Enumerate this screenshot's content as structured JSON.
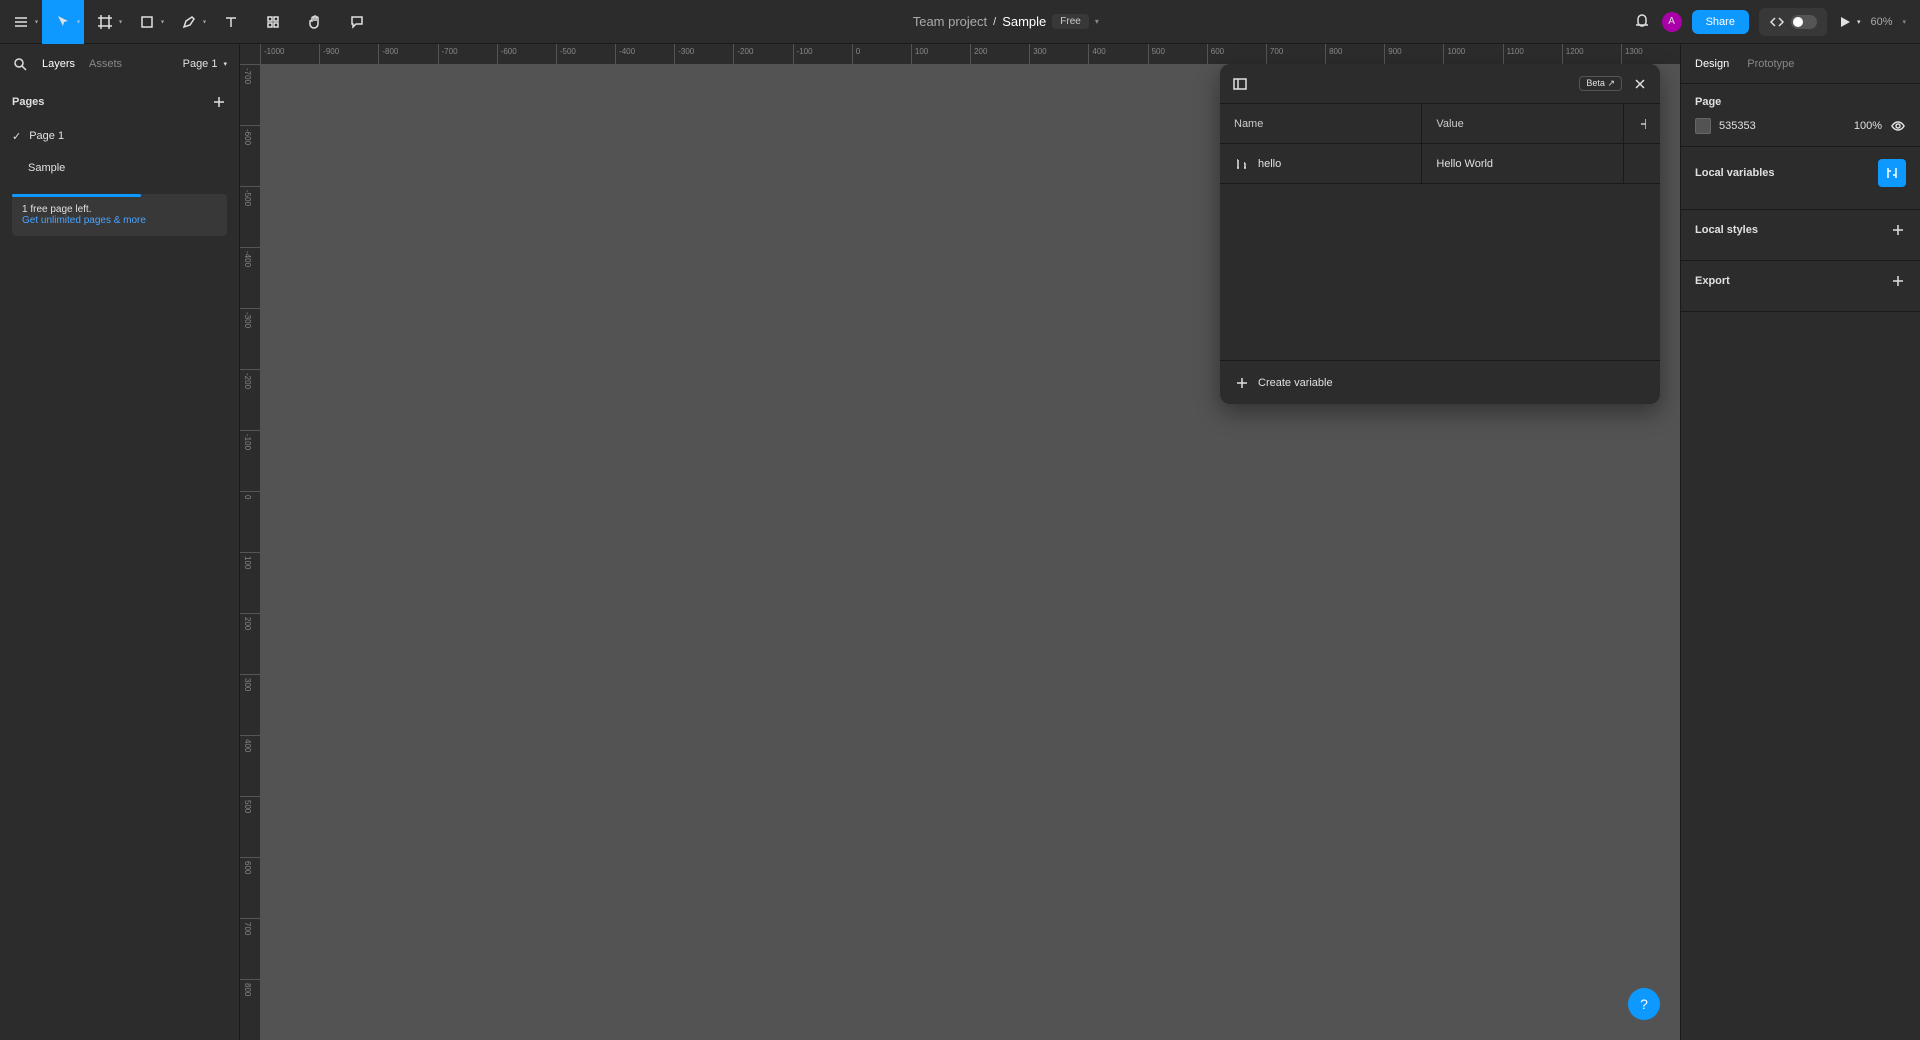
{
  "toolbar": {
    "team_project": "Team project",
    "separator": "/",
    "file_name": "Sample",
    "plan_badge": "Free",
    "share": "Share",
    "zoom": "60%"
  },
  "left_panel": {
    "tabs": {
      "layers": "Layers",
      "assets": "Assets"
    },
    "page_selector": "Page 1",
    "pages": {
      "title": "Pages",
      "items": [
        "Page 1"
      ]
    },
    "layers": [
      "Sample"
    ],
    "info": {
      "line1": "1 free page left.",
      "link": "Get unlimited pages & more"
    }
  },
  "rulers": {
    "horizontal": [
      "-1000",
      "-900",
      "-800",
      "-700",
      "-600",
      "-500",
      "-400",
      "-300",
      "-200",
      "-100",
      "0",
      "100",
      "200",
      "300",
      "400",
      "500",
      "600",
      "700",
      "800",
      "900",
      "1000",
      "1100",
      "1200",
      "1300"
    ],
    "vertical": [
      "-700",
      "-600",
      "-500",
      "-400",
      "-300",
      "-200",
      "-100",
      "0",
      "100",
      "200",
      "300",
      "400",
      "500",
      "600",
      "700",
      "800"
    ]
  },
  "variables_panel": {
    "beta": "Beta",
    "columns": {
      "name": "Name",
      "value": "Value"
    },
    "rows": [
      {
        "name": "hello",
        "value": "Hello World"
      }
    ],
    "create": "Create variable"
  },
  "right_panel": {
    "tabs": {
      "design": "Design",
      "prototype": "Prototype"
    },
    "page_section": {
      "title": "Page",
      "bg_hex": "535353",
      "bg_opacity": "100%"
    },
    "local_variables": "Local variables",
    "local_styles": "Local styles",
    "export": "Export"
  },
  "help": "?"
}
